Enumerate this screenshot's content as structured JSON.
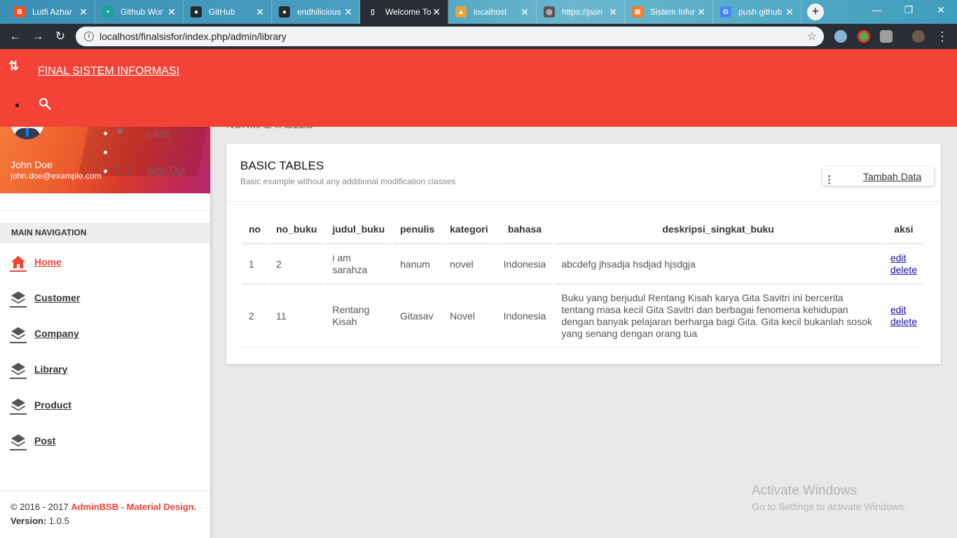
{
  "browser": {
    "tabs": [
      {
        "title": "Lutfi Azhar",
        "icon_color": "#f4511e",
        "icon_char": "B"
      },
      {
        "title": "Github Wor",
        "icon_color": "#1aa39b",
        "icon_char": "•"
      },
      {
        "title": "GitHub",
        "icon_color": "#24292e",
        "icon_char": "●"
      },
      {
        "title": "endhilicious",
        "icon_color": "#24292e",
        "icon_char": "●"
      },
      {
        "title": "Welcome To",
        "icon_color": "#2b2f35",
        "icon_char": "▯"
      },
      {
        "title": "localhost",
        "icon_color": "#e8a33d",
        "icon_char": "▲"
      },
      {
        "title": "https://json",
        "icon_color": "#555555",
        "icon_char": "◎"
      },
      {
        "title": "Sistem Infor",
        "icon_color": "#fb7a24",
        "icon_char": "⊠"
      },
      {
        "title": "push github",
        "icon_color": "#4285f4",
        "icon_char": "G"
      }
    ],
    "url": "localhost/finalsisfor/index.php/admin/library"
  },
  "topbar": {
    "brand": "FINAL SISTEM INFORMASI",
    "bg_color": "#f44336"
  },
  "user": {
    "name": "John Doe",
    "email": "john.doe@example.com",
    "dropdown": [
      "Likes",
      "",
      "Sign Out"
    ]
  },
  "sidebar": {
    "header": "MAIN NAVIGATION",
    "items": [
      {
        "label": "Home",
        "icon": "home-icon",
        "active": true
      },
      {
        "label": "Customer",
        "icon": "layers-icon",
        "active": false
      },
      {
        "label": "Company",
        "icon": "layers-icon",
        "active": false
      },
      {
        "label": "Library",
        "icon": "layers-icon",
        "active": false
      },
      {
        "label": "Product",
        "icon": "layers-icon",
        "active": false
      },
      {
        "label": "Post",
        "icon": "layers-icon",
        "active": false
      }
    ],
    "footer": {
      "copyright_prefix": "© 2016 - 2017 ",
      "brand": "AdminBSB - Material Design.",
      "version_label": "Version:",
      "version": " 1.0.5"
    }
  },
  "content": {
    "section_title": "NORMAL TABLES",
    "card_title": "BASIC TABLES",
    "card_subtitle": "Basic example without any additional modification classes",
    "add_button": "Tambah Data",
    "table": {
      "columns": [
        "no",
        "no_buku",
        "judul_buku",
        "penulis",
        "kategori",
        "bahasa",
        "deskripsi_singkat_buku",
        "aksi"
      ],
      "rows": [
        {
          "no": "1",
          "no_buku": "2",
          "judul_buku": "i am sarahza",
          "penulis": "hanum",
          "kategori": "novel",
          "bahasa": "Indonesia",
          "deskripsi": "abcdefg jhsadja hsdjad hjsdgja",
          "edit": "edit",
          "delete": "delete"
        },
        {
          "no": "2",
          "no_buku": "11",
          "judul_buku": "Rentang Kisah",
          "penulis": "Gitasav",
          "kategori": "Novel",
          "bahasa": "Indonesia",
          "deskripsi": "Buku yang berjudul Rentang Kisah karya Gita Savitri ini bercerita tentang masa kecil Gita Savitri dan berbagai fenomena kehidupan dengan banyak pelajaran berharga bagi Gita. Gita kecil bukanlah sosok yang senang dengan orang tua",
          "edit": "edit",
          "delete": "delete"
        }
      ]
    }
  },
  "watermark": {
    "line1": "Activate Windows",
    "line2": "Go to Settings to activate Windows."
  }
}
